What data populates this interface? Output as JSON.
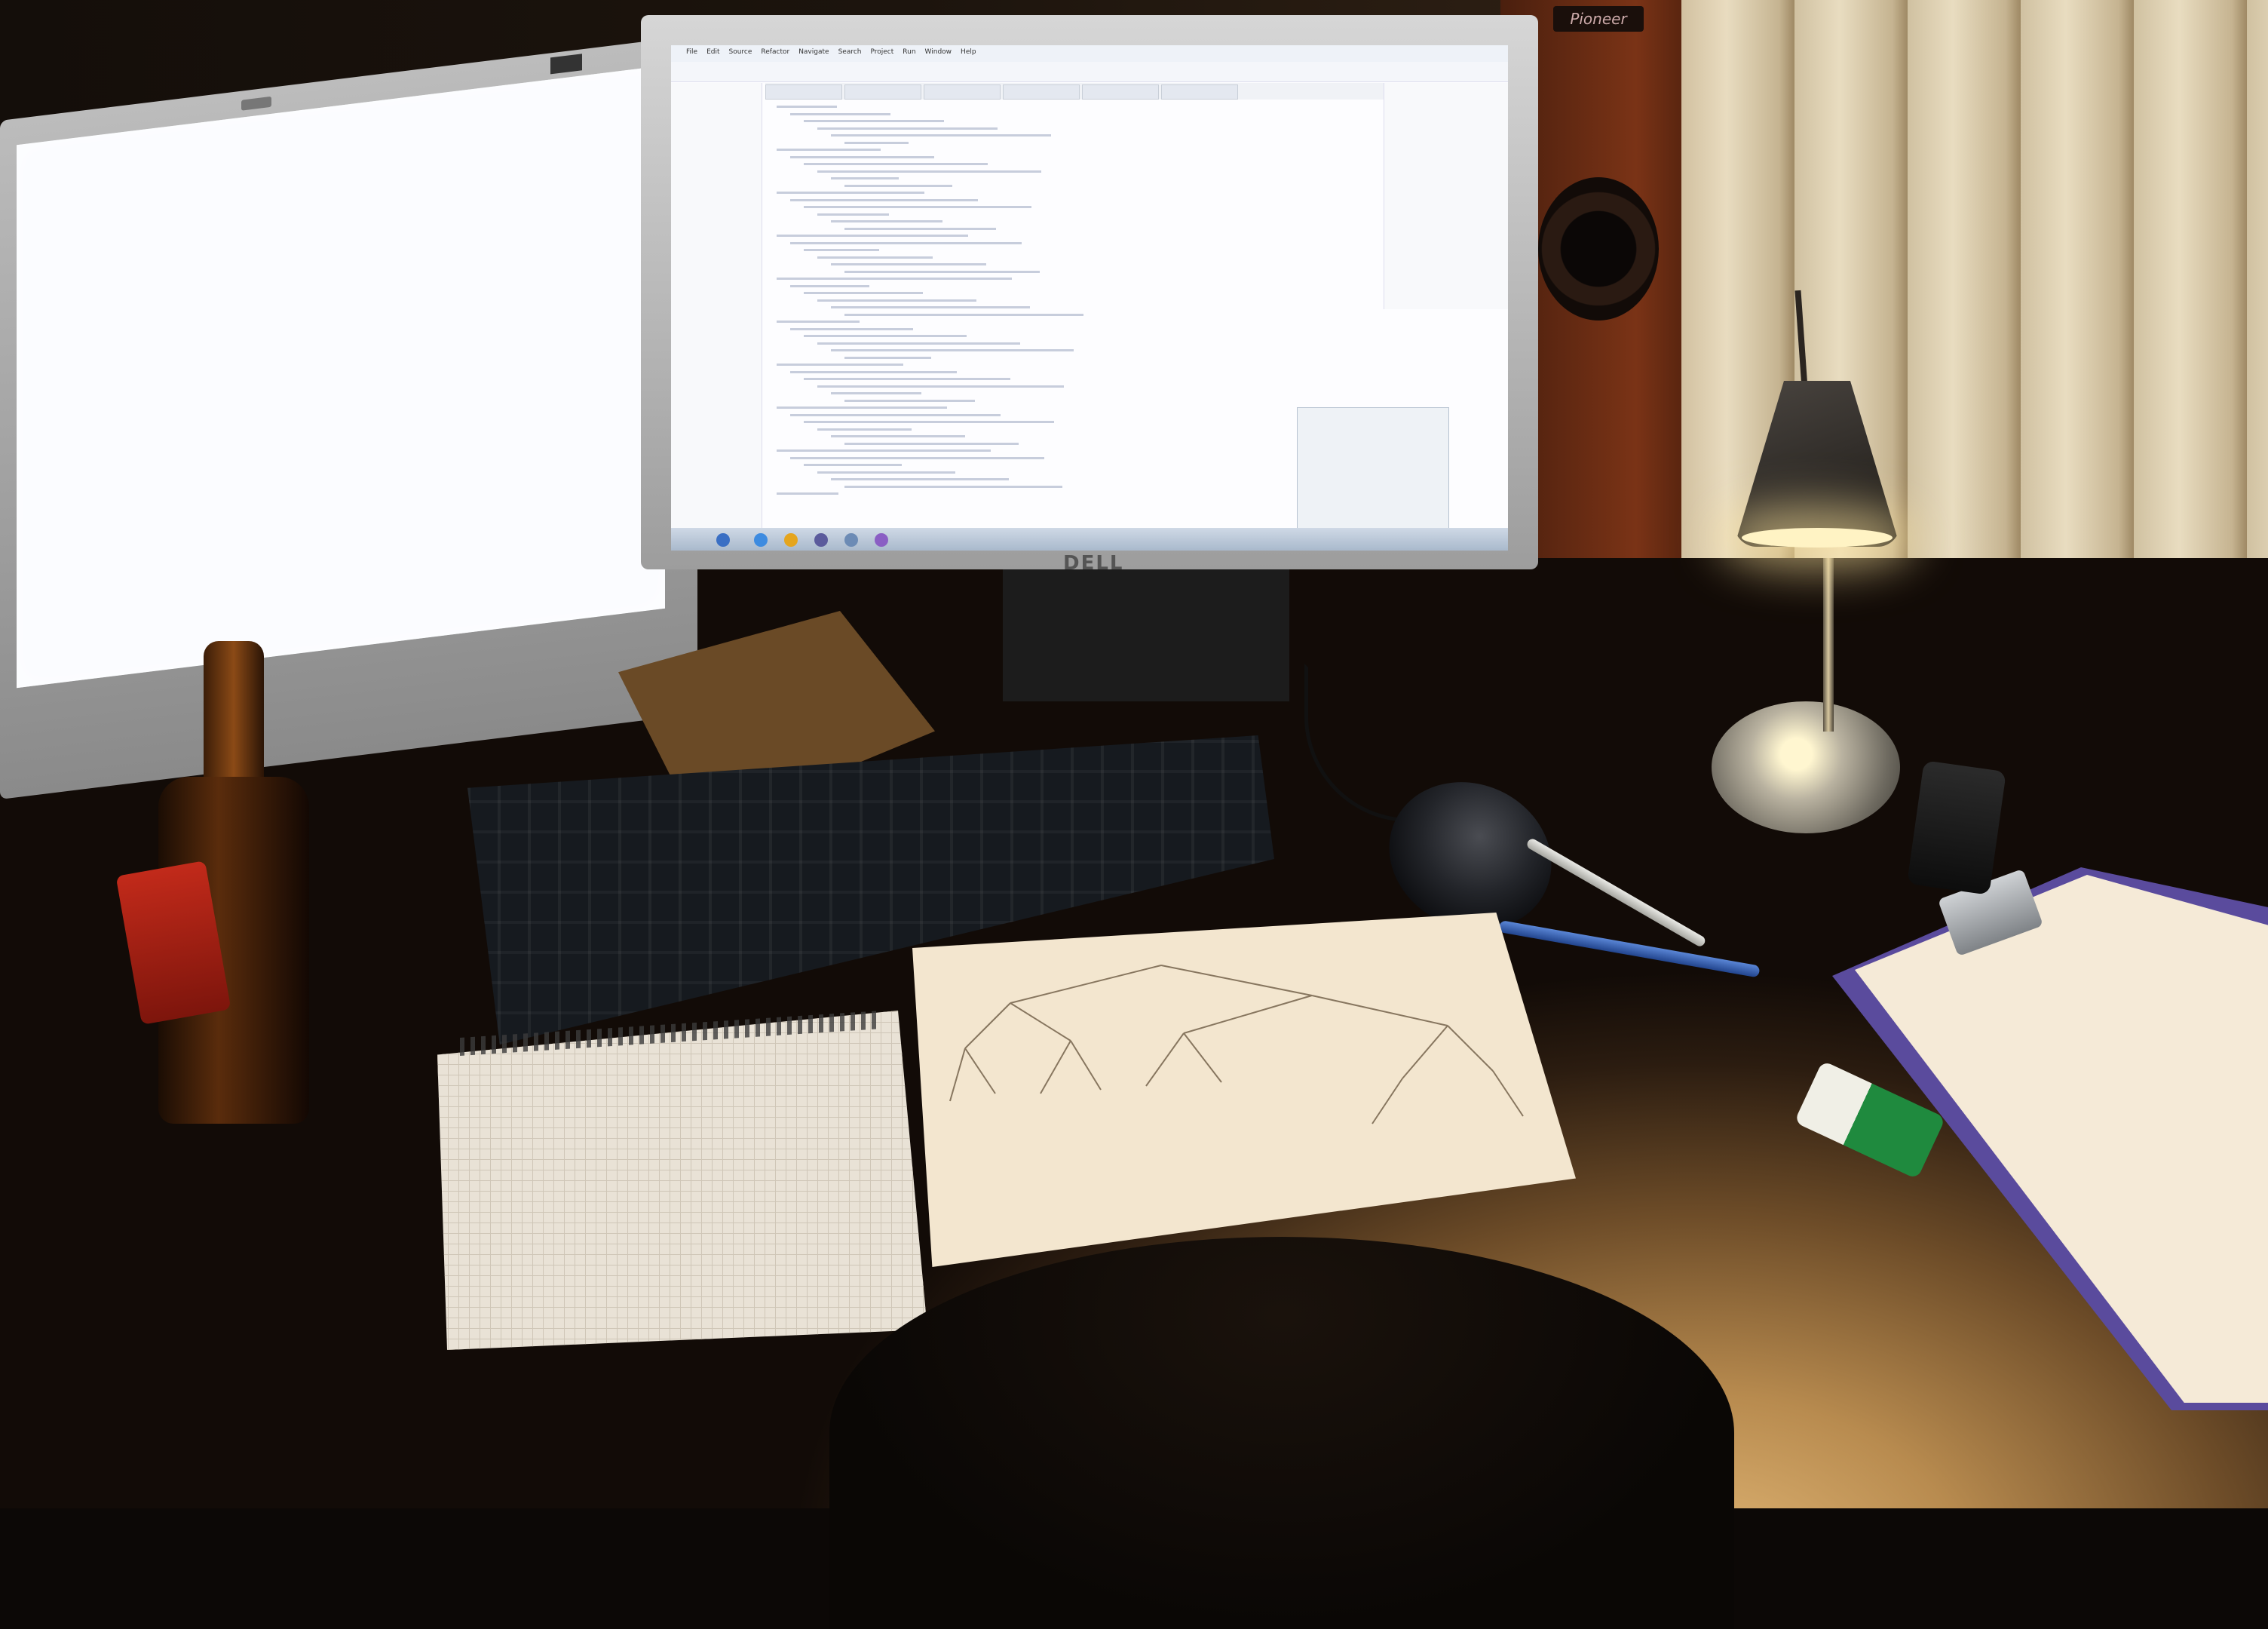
{
  "scene": {
    "description_tags": [
      "desk",
      "dual-monitor",
      "lamp",
      "beer-bottle",
      "keyboard",
      "mouse",
      "notepad",
      "paper-sketch",
      "clipboard"
    ]
  },
  "left_monitor": {
    "brand_badge": ""
  },
  "right_monitor": {
    "brand_label": "DELL",
    "ide": {
      "menu_items": [
        "File",
        "Edit",
        "Source",
        "Refactor",
        "Navigate",
        "Search",
        "Project",
        "Run",
        "Window",
        "Help"
      ],
      "tabs": [
        "",
        "",
        "",
        "",
        "",
        ""
      ]
    }
  },
  "speaker": {
    "brand_label": "Pioneer"
  },
  "colors": {
    "lamp_light": "#fff3c4",
    "bottle_label": "#c22a1a",
    "clipboard": "#5a4b9d",
    "pen_blue": "#2b56a8"
  }
}
